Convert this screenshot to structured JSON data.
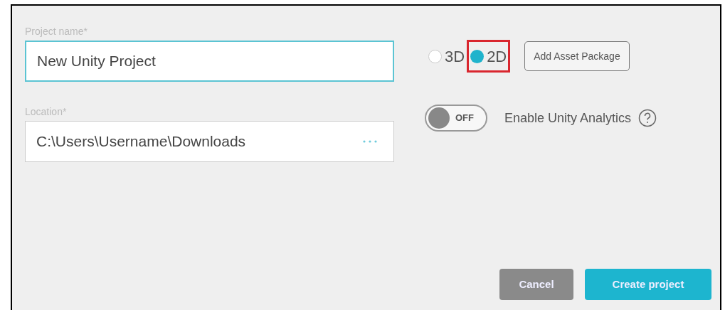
{
  "fields": [
    {
      "label": "Project name*",
      "value": "New Unity Project",
      "focused": true,
      "browse": false
    },
    {
      "label": "Location*",
      "value": "C:\\Users\\Username\\Downloads",
      "focused": false,
      "browse": true
    }
  ],
  "modes": [
    {
      "label": "3D",
      "selected": false,
      "highlighted": false
    },
    {
      "label": "2D",
      "selected": true,
      "highlighted": true
    }
  ],
  "asset_button": "Add Asset Package",
  "analytics": {
    "toggle_label": "OFF",
    "on": false,
    "label": "Enable Unity Analytics"
  },
  "buttons": [
    {
      "label": "Cancel",
      "kind": "secondary"
    },
    {
      "label": "Create project",
      "kind": "primary"
    }
  ]
}
